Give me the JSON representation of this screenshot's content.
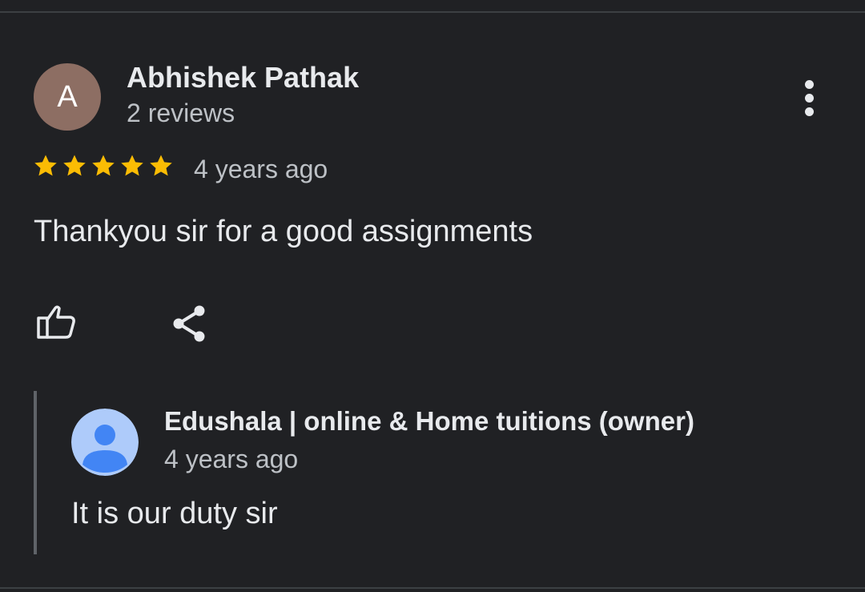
{
  "review": {
    "avatar_letter": "A",
    "avatar_color": "#8d6e63",
    "author_name": "Abhishek Pathak",
    "review_count": "2 reviews",
    "rating": 5,
    "rating_max": 5,
    "time_ago": "4 years ago",
    "text": "Thankyou sir for a good assignments",
    "star_color": "#fbbc04",
    "more_icon": "more-vertical-icon",
    "like_icon": "thumbs-up-icon",
    "share_icon": "share-icon"
  },
  "owner_reply": {
    "name": "Edushala | online & Home tuitions (owner)",
    "time_ago": "4 years ago",
    "text": "It is our duty sir",
    "avatar_icon": "default-profile-icon",
    "avatar_bg": "#aecbfa",
    "avatar_fg": "#4285f4"
  },
  "theme": {
    "background": "#202124",
    "primary_text": "#e8eaed",
    "secondary_text": "#bdc1c6"
  }
}
